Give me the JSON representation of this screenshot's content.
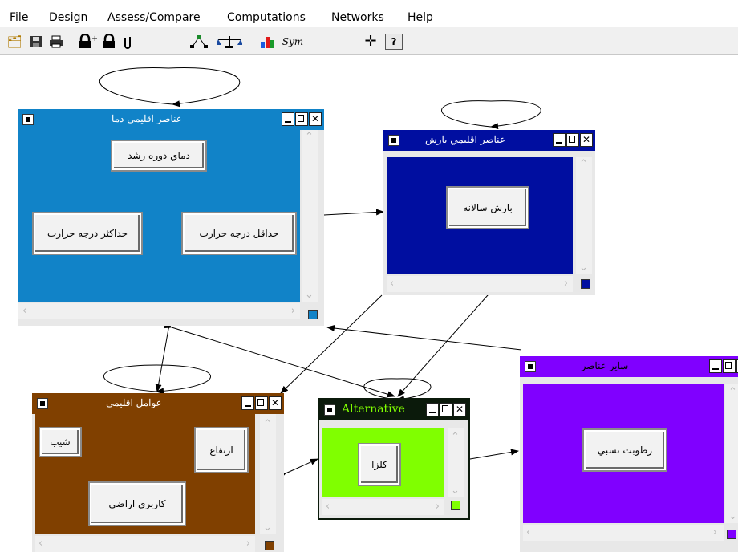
{
  "menu": [
    "File",
    "Design",
    "Assess/Compare",
    "Computations",
    "Networks",
    "Help"
  ],
  "toolbar": {
    "items": [
      {
        "name": "open-icon",
        "glyph": "📂"
      },
      {
        "name": "save-icon",
        "glyph": "💾"
      },
      {
        "name": "print-icon",
        "glyph": "🖶"
      },
      {
        "name": "lock-plus-icon",
        "glyph": "🔒"
      },
      {
        "name": "lock-icon",
        "glyph": "🔒"
      },
      {
        "name": "attach-icon",
        "glyph": "⎁"
      },
      {
        "name": "tree-icon",
        "glyph": "⋔"
      },
      {
        "name": "balance-icon",
        "glyph": "⚖"
      },
      {
        "name": "bar-chart-icon",
        "glyph": "▆"
      },
      {
        "name": "sym-icon",
        "glyph": "Sym"
      },
      {
        "name": "crosshair-icon",
        "glyph": "✛"
      },
      {
        "name": "help-icon",
        "glyph": "?"
      }
    ]
  },
  "windows": {
    "temp": {
      "title": "عناصر اقليمي دما",
      "color": "#1183c8",
      "nodes": [
        "دماي دوره رشد",
        "حداكثر درجه حرارت",
        "حداقل درجه حرارت"
      ]
    },
    "rain": {
      "title": "عناصر اقليمي بارش",
      "color": "#000ea0",
      "nodes": [
        "بارش سالانه"
      ]
    },
    "geo": {
      "title": "عوامل اقليمي",
      "color": "#804000",
      "nodes": [
        "شيب",
        "ارتفاع",
        "كاربري اراضي"
      ]
    },
    "alt": {
      "title": "Alternative",
      "color": "#80ff00",
      "nodes": [
        "كلزا"
      ]
    },
    "other": {
      "title": "ساير عناصر",
      "color": "#8000ff",
      "nodes": [
        "رطوبت نسبي"
      ]
    }
  }
}
